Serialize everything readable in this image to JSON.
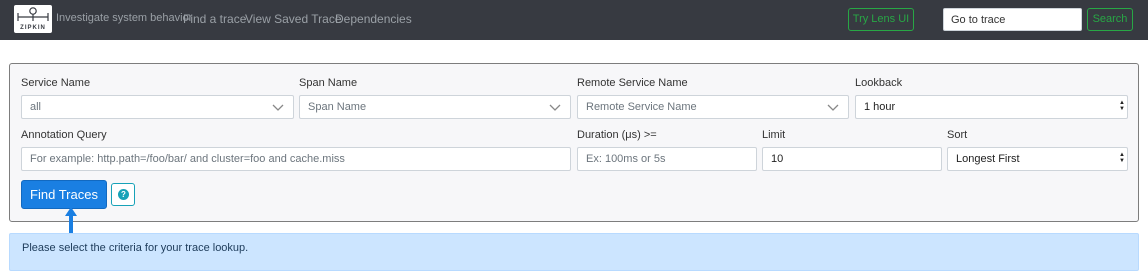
{
  "navbar": {
    "logo_text": "ZIPKIN",
    "brand": "Investigate system behavior",
    "links": [
      "Find a trace",
      "View Saved Trace",
      "Dependencies"
    ],
    "lens_button": "Try Lens UI",
    "goto_placeholder": "Go to trace",
    "search_button": "Search",
    "colors": {
      "background": "#373a41",
      "success": "#28a745"
    }
  },
  "form": {
    "service_name": {
      "label": "Service Name",
      "value": "all"
    },
    "span_name": {
      "label": "Span Name",
      "value": "Span Name"
    },
    "remote_service_name": {
      "label": "Remote Service Name",
      "value": "Remote Service Name"
    },
    "lookback": {
      "label": "Lookback",
      "value": "1 hour"
    },
    "annotation_query": {
      "label": "Annotation Query",
      "placeholder": "For example: http.path=/foo/bar/ and cluster=foo and cache.miss"
    },
    "duration": {
      "label": "Duration (μs) >=",
      "placeholder": "Ex: 100ms or 5s"
    },
    "limit": {
      "label": "Limit",
      "value": "10"
    },
    "sort": {
      "label": "Sort",
      "value": "Longest First"
    },
    "find_button": "Find Traces",
    "help_icon": "question-circle-icon",
    "colors": {
      "primary": "#1a7fe2",
      "info": "#17a2b8"
    }
  },
  "alert": {
    "message": "Please select the criteria for your trace lookup.",
    "color": "#cce5ff"
  }
}
